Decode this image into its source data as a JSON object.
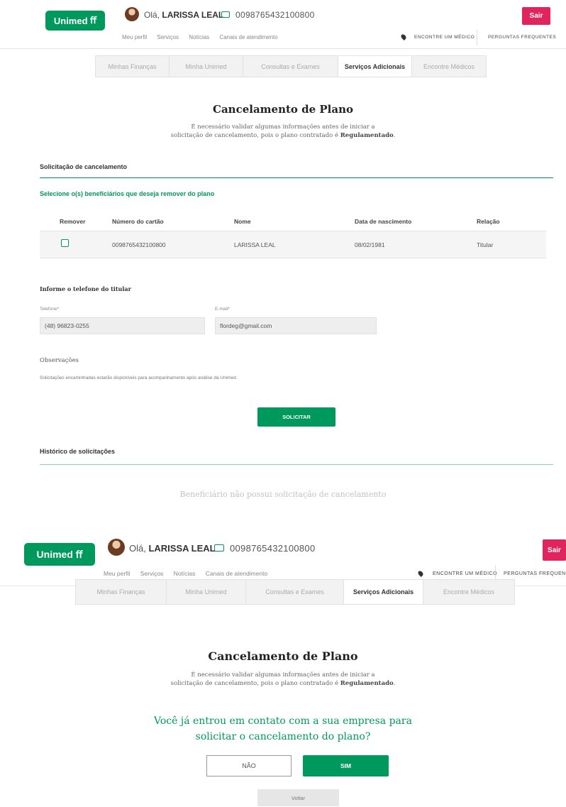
{
  "brand": {
    "logo_text": "Unimed",
    "accent": "#00995d",
    "danger": "#e0245e"
  },
  "header": {
    "greeting": "Olá,",
    "user_name": "LARISSA LEAL",
    "card_number": "0098765432100800",
    "logout_label": "Sair",
    "links": [
      "Meu perfil",
      "Serviços",
      "Notícias",
      "Canais de atendimento"
    ],
    "find_doctor": "ENCONTRE UM MÉDICO",
    "faq": "PERGUNTAS FREQUENTES",
    "icons": {
      "user": "avatar",
      "card": "card-icon",
      "pin": "pin-icon"
    }
  },
  "tabs": [
    {
      "label": "Minhas Finanças",
      "active": false
    },
    {
      "label": "Minha Unimed",
      "active": false
    },
    {
      "label": "Consultas e Exames",
      "active": false
    },
    {
      "label": "Serviços Adicionais",
      "active": true
    },
    {
      "label": "Encontre Médicos",
      "active": false
    }
  ],
  "page": {
    "title": "Cancelamento de Plano",
    "subtitle_line1": "É necessário validar algumas informações antes de iniciar a",
    "subtitle_line2_prefix": "solicitação de cancelamento, pois o plano contratado é ",
    "subtitle_line2_bold": "Regulamentado",
    "subtitle_line2_suffix": "."
  },
  "cancel_request": {
    "section_title": "Solicitação de cancelamento",
    "select_label": "Selecione o(s) beneficiários que deseja remover do plano",
    "columns": [
      "Remover",
      "Número do cartão",
      "Nome",
      "Data de nascimento",
      "Relação"
    ],
    "rows": [
      {
        "remove": false,
        "card": "0098765432100800",
        "name": "LARISSA LEAL",
        "birth": "08/02/1981",
        "relation": "Titular"
      }
    ],
    "phone_title": "Informe o telefone do titular",
    "phone_label": "Telefone*",
    "phone_value": "(48) 96823-0255",
    "email_label": "E-mail*",
    "email_value": "flordeg@gmail.com",
    "obs_title": "Observações",
    "obs_text": "Solicitações encaminhadas estarão disponíveis para acompanhamento após análise da Unimed.",
    "submit_label": "SOLICITAR"
  },
  "history": {
    "section_title": "Histórico de solicitações",
    "empty_message": "Beneficiário não possui solicitação de cancelamento"
  },
  "confirm": {
    "question_line1": "Você já entrou em contato com a sua empresa para",
    "question_line2": "solicitar o cancelamento do plano?",
    "no_label": "NÃO",
    "yes_label": "SIM",
    "back_label": "Voltar"
  }
}
